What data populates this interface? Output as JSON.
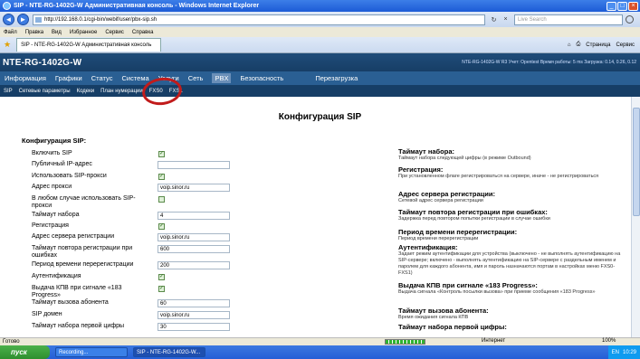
{
  "window": {
    "title": "SIP - NTE-RG-1402G-W Административная консоль - Windows Internet Explorer",
    "buttons": [
      "_",
      "□",
      "×"
    ]
  },
  "addressbar": {
    "url": "http://192.168.0.1/cgi-bin/webif/user/pbx-sip.sh",
    "search_placeholder": "Live Search"
  },
  "menubar": {
    "items": [
      "Файл",
      "Правка",
      "Вид",
      "Избранное",
      "Сервис",
      "Справка"
    ]
  },
  "tabbar": {
    "tab_label": "SIP - NTE-RG-1402G-W Административная консоль",
    "tools": [
      "Страница",
      "Сервис"
    ]
  },
  "page": {
    "logo": "NTE-RG-1402G-W",
    "device_info": "NTE-RG-1402G-W R3 Учет: Opentest Время работы: 5 ms Загрузка: 0.14, 0.26, 0.12",
    "nav1": [
      "Информация",
      "Графики",
      "Статус",
      "Система",
      "Услуги",
      "Сеть",
      "PBX",
      "Безопасность",
      "Перезагрузка"
    ],
    "nav1_active": "PBX",
    "nav2": [
      "SIP",
      "Сетевые параметры",
      "Кодеки",
      "План нумерации",
      "FXS0",
      "FXS1"
    ],
    "title": "Конфигурация SIP",
    "section_title": "Конфигурация SIP:"
  },
  "form": {
    "rows": [
      {
        "label": "Включить SIP",
        "type": "checkbox",
        "checked": true
      },
      {
        "label": "Публичный IP-адрес",
        "type": "input",
        "value": ""
      },
      {
        "label": "Использовать SIP-прокси",
        "type": "checkbox",
        "checked": true
      },
      {
        "label": "Адрес прокси",
        "type": "input",
        "value": "voip.sinor.ru"
      },
      {
        "label": "В любом случае использовать SIP-прокси",
        "type": "checkbox",
        "checked": false
      },
      {
        "label": "Таймаут набора",
        "type": "input",
        "value": "4"
      },
      {
        "label": "Регистрация",
        "type": "checkbox",
        "checked": true
      },
      {
        "label": "Адрес сервера регистрации",
        "type": "input",
        "value": "voip.sinor.ru"
      },
      {
        "label": "Таймаут повтора регистрации при ошибках",
        "type": "input",
        "value": "600"
      },
      {
        "label": "Период времени перерегистрации",
        "type": "input",
        "value": "200"
      },
      {
        "label": "Аутентификация",
        "type": "checkbox",
        "checked": true
      },
      {
        "label": "Выдача КПВ при сигнале «183 Progress»",
        "type": "checkbox",
        "checked": true
      },
      {
        "label": "Таймаут вызова абонента",
        "type": "input",
        "value": "60"
      },
      {
        "label": "SIP домен",
        "type": "input",
        "value": "voip.sinor.ru"
      },
      {
        "label": "Таймаут набора первой цифры",
        "type": "input",
        "value": "30"
      }
    ]
  },
  "help": [
    {
      "title": "Таймаут набора:",
      "text": "Таймаут набора следующей цифры (в режиме Outbound)"
    },
    {
      "title": "Регистрация:",
      "text": "При установленном флаге регистрироваться на сервере, иначе - не регистрироваться"
    },
    {
      "title": "Адрес сервера регистрации:",
      "text": "Сетевой адрес сервера регистрации"
    },
    {
      "title": "Таймаут повтора регистрации при ошибках:",
      "text": "Задержка перед повтором попытки регистрации в случае ошибки"
    },
    {
      "title": "Период времени перерегистрации:",
      "text": "Период времени перерегистрации"
    },
    {
      "title": "Аутентификация:",
      "text": "Задает режим аутентификации для устройства (выключено - не выполнять аутентификацию на SIP-сервере; включено - выполнять аутентификацию на SIP-сервере с раздельным именем и паролем для каждого абонента, имя и пароль назначаются портам в настройках меню FXS0-FXS1)"
    },
    {
      "title": "Выдача КПВ при сигнале «183 Progress»:",
      "text": "Выдача сигнала «Контроль посылки вызова» при приеме сообщения «183 Progress»"
    },
    {
      "title": "Таймаут вызова абонента:",
      "text": "Время ожидания сигнала КПВ"
    },
    {
      "title": "Таймаут набора первой цифры:",
      "text": ""
    }
  ],
  "status": {
    "text": "Готово",
    "zone": "Интернет",
    "zoom": "100%"
  },
  "taskbar": {
    "start": "пуск",
    "tasks": [
      "Recording...",
      "SIP - NTE-RG-1402G-W..."
    ],
    "time": "10:29",
    "lang": "EN"
  }
}
